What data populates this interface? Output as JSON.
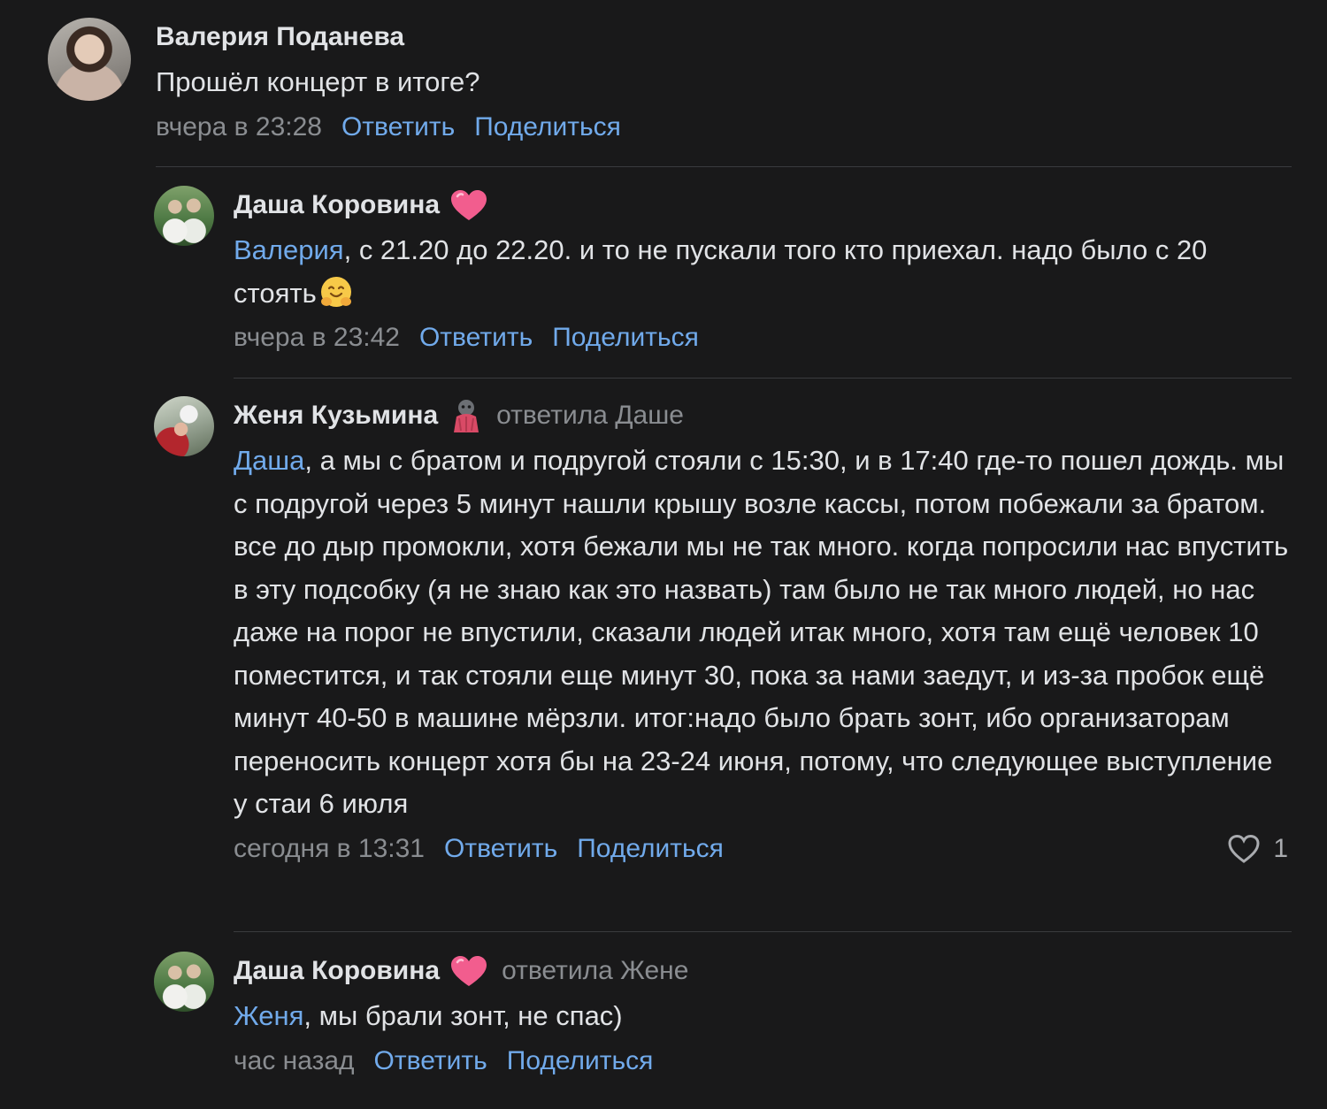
{
  "comments": [
    {
      "author": "Валерия Поданева",
      "avatar": "avatar-valeria",
      "text": "Прошёл концерт в итоге?",
      "time": "вчера в 23:28",
      "reply_label": "Ответить",
      "share_label": "Поделиться"
    },
    {
      "author": "Даша Коровина",
      "avatar": "avatar-dasha",
      "badge_icon": "pink-heart-icon",
      "mention": "Валерия",
      "text": ", с 21.20 до 22.20. и то не пускали того кто приехал. надо было с 20 стоять",
      "emoji_icon": "hugging-face-emoji",
      "time": "вчера в 23:42",
      "reply_label": "Ответить",
      "share_label": "Поделиться"
    },
    {
      "author": "Женя Кузьмина",
      "avatar": "avatar-zhenya",
      "badge_icon": "ghost-sticker-icon",
      "replied_to": "ответила Даше",
      "mention": "Даша",
      "text": ", а мы с братом и подругой стояли с 15:30, и в 17:40 где-то пошел дождь. мы с подругой через 5 минут нашли крышу возле кассы, потом побежали за братом. все до дыр промокли, хотя бежали мы не так много. когда попросили нас впустить в эту подсобку (я не знаю как это назвать) там было не так много людей, но нас даже на порог не впустили, сказали людей итак много, хотя там ещё человек 10 поместится, и так стояли еще минут 30, пока за нами заедут, и из-за пробок ещё минут 40-50 в машине мёрзли. итог:надо было брать зонт, ибо организаторам переносить концерт хотя бы на 23-24 июня, потому, что следующее выступление у стаи 6 июля",
      "time": "сегодня в 13:31",
      "reply_label": "Ответить",
      "share_label": "Поделиться",
      "like_count": "1"
    },
    {
      "author": "Даша Коровина",
      "avatar": "avatar-dasha",
      "badge_icon": "pink-heart-icon",
      "replied_to": "ответила Жене",
      "mention": "Женя",
      "text": ", мы брали зонт, не спас)",
      "time": "час назад",
      "reply_label": "Ответить",
      "share_label": "Поделиться"
    }
  ],
  "colors": {
    "background": "#19191a",
    "text": "#e1e3e6",
    "link": "#71aaeb",
    "secondary": "#8a8d91",
    "heart_badge": "#f25d8e"
  }
}
